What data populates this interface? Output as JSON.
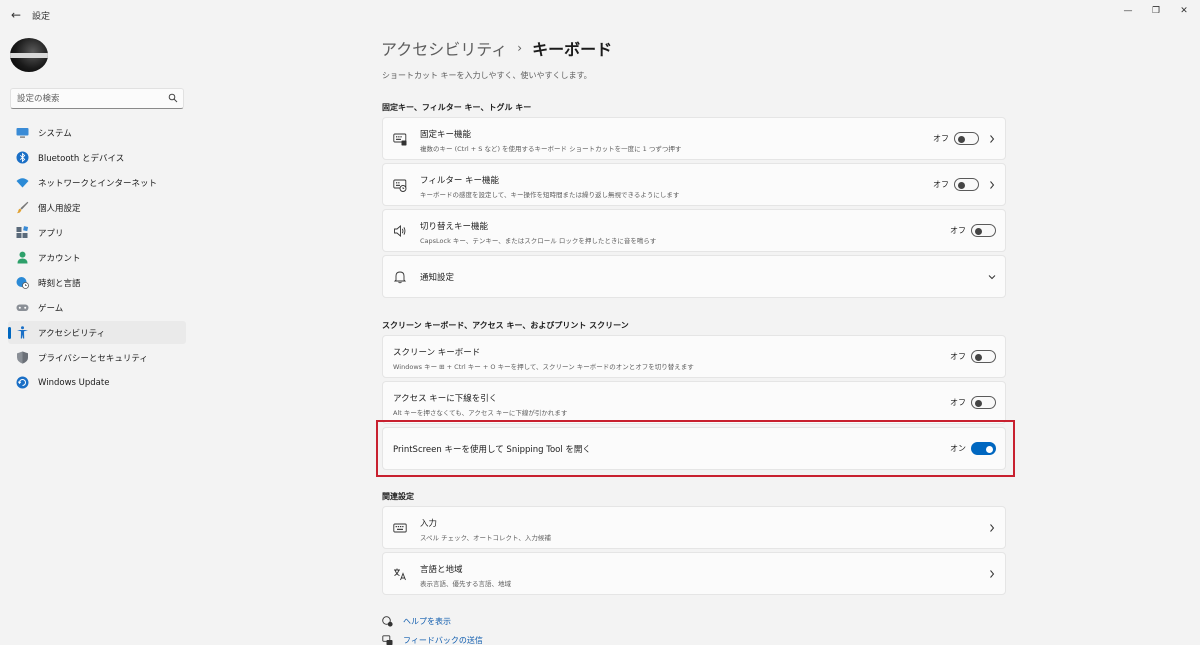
{
  "window": {
    "title": "設定",
    "back": "←",
    "minimize": "—",
    "maximize": "❐",
    "close": "✕"
  },
  "sidebar": {
    "search_placeholder": "設定の検索",
    "items": [
      {
        "label": "システム",
        "icon": "monitor-icon"
      },
      {
        "label": "Bluetooth とデバイス",
        "icon": "bluetooth-icon"
      },
      {
        "label": "ネットワークとインターネット",
        "icon": "wifi-icon"
      },
      {
        "label": "個人用設定",
        "icon": "brush-icon"
      },
      {
        "label": "アプリ",
        "icon": "apps-icon"
      },
      {
        "label": "アカウント",
        "icon": "person-icon"
      },
      {
        "label": "時刻と言語",
        "icon": "globe-clock-icon"
      },
      {
        "label": "ゲーム",
        "icon": "gamepad-icon"
      },
      {
        "label": "アクセシビリティ",
        "icon": "accessibility-icon",
        "active": true
      },
      {
        "label": "プライバシーとセキュリティ",
        "icon": "shield-icon"
      },
      {
        "label": "Windows Update",
        "icon": "update-icon"
      }
    ]
  },
  "breadcrumb": {
    "parent": "アクセシビリティ",
    "separator": "›",
    "current": "キーボード"
  },
  "page_description": "ショートカット キーを入力しやすく、使いやすくします。",
  "sections": {
    "sticky": "固定キー、フィルター キー、トグル キー",
    "screen_keyboard": "スクリーン キーボード、アクセス キー、およびプリント スクリーン",
    "related": "関連設定"
  },
  "cards": {
    "sticky_keys": {
      "title": "固定キー機能",
      "desc": "複数のキー (Ctrl + S など) を使用するキーボード ショートカットを一度に 1 つずつ押す",
      "state": "オフ"
    },
    "filter_keys": {
      "title": "フィルター キー機能",
      "desc": "キーボードの感度を設定して、キー操作を短時間または繰り返し無視できるようにします",
      "state": "オフ"
    },
    "toggle_keys": {
      "title": "切り替えキー機能",
      "desc": "CapsLock キー、テンキー、またはスクロール ロックを押したときに音を鳴らす",
      "state": "オフ"
    },
    "notification": {
      "title": "通知設定"
    },
    "on_screen_keyboard": {
      "title": "スクリーン キーボード",
      "desc": "Windows キー ⊞ + Ctrl キー + O キーを押して、スクリーン キーボードのオンとオフを切り替えます",
      "state": "オフ"
    },
    "access_keys": {
      "title": "アクセス キーに下線を引く",
      "desc": "Alt キーを押さなくても、アクセス キーに下線が引かれます",
      "state": "オフ"
    },
    "print_screen": {
      "title": "PrintScreen キーを使用して Snipping Tool を開く",
      "state": "オン"
    },
    "typing": {
      "title": "入力",
      "desc": "スペル チェック、オートコレクト、入力候補"
    },
    "language": {
      "title": "言語と地域",
      "desc": "表示言語、優先する言語、地域"
    }
  },
  "links": {
    "help": "ヘルプを表示",
    "feedback": "フィードバックの送信"
  },
  "colors": {
    "accent": "#0067c0",
    "highlight": "#c8202f",
    "link": "#0f5cae"
  }
}
